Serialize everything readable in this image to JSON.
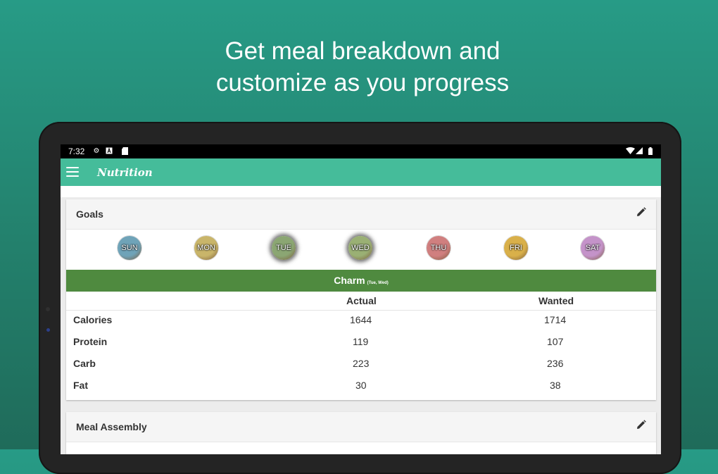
{
  "promo": {
    "headline_line1": "Get meal breakdown and",
    "headline_line2": "customize as you progress"
  },
  "status_bar": {
    "time": "7:32"
  },
  "app_bar": {
    "title": "Nutrition"
  },
  "goals": {
    "title": "Goals",
    "days": [
      {
        "label": "SUN",
        "active": false,
        "color": "#6fa3b8"
      },
      {
        "label": "MON",
        "active": false,
        "color": "#c9b56a"
      },
      {
        "label": "TUE",
        "active": true,
        "color": "#8ba673"
      },
      {
        "label": "WED",
        "active": true,
        "color": "#9ab074"
      },
      {
        "label": "THU",
        "active": false,
        "color": "#d07f7f"
      },
      {
        "label": "FRI",
        "active": false,
        "color": "#d9b04a"
      },
      {
        "label": "SAT",
        "active": false,
        "color": "#c493c9"
      }
    ],
    "plan_name": "Charm",
    "plan_days": "(Tue, Wed)",
    "columns": {
      "actual": "Actual",
      "wanted": "Wanted"
    },
    "rows": [
      {
        "label": "Calories",
        "actual": "1644",
        "wanted": "1714"
      },
      {
        "label": "Protein",
        "actual": "119",
        "wanted": "107"
      },
      {
        "label": "Carb",
        "actual": "223",
        "wanted": "236"
      },
      {
        "label": "Fat",
        "actual": "30",
        "wanted": "38"
      }
    ]
  },
  "meal_assembly": {
    "title": "Meal Assembly"
  },
  "colors": {
    "appbar": "#45bc9a",
    "plan_bar": "#4f8a3f",
    "background": "#279b86"
  }
}
